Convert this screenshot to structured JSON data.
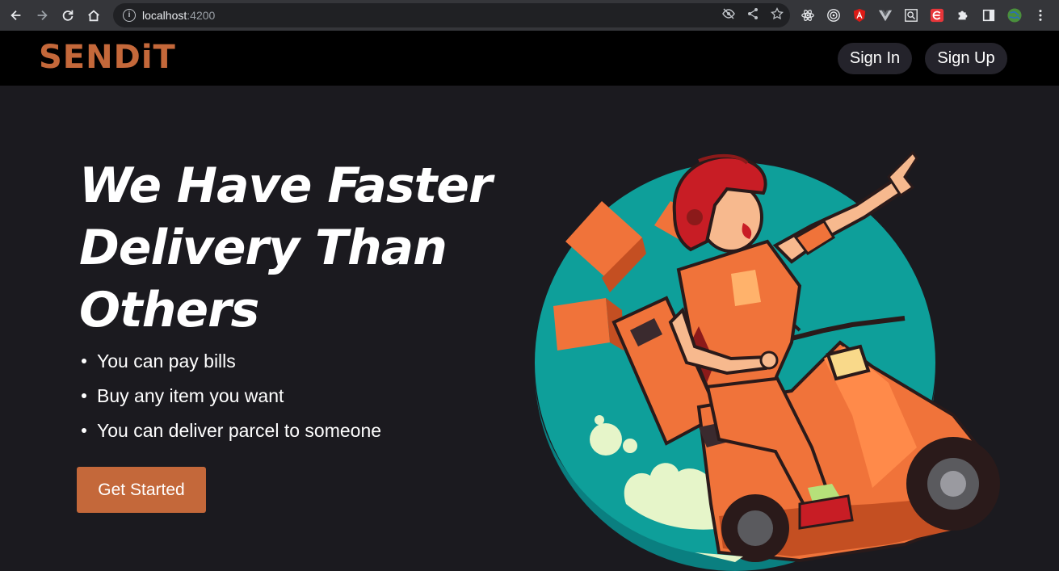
{
  "browser": {
    "url_host": "localhost",
    "url_port": ":4200",
    "nav_icons": [
      "back-arrow-icon",
      "forward-arrow-icon",
      "reload-icon",
      "home-icon"
    ],
    "omnibox_icons": [
      "info-icon",
      "eye-off-icon",
      "share-icon",
      "star-icon"
    ],
    "extension_icons": [
      "react-devtools-icon",
      "target-icon",
      "angular-icon",
      "vue-icon",
      "search-ext-icon",
      "e-ext-icon",
      "puzzle-icon",
      "sidepanel-icon",
      "profile-avatar-icon",
      "kebab-menu-icon"
    ]
  },
  "header": {
    "logo": "SENDiT",
    "sign_in": "Sign In",
    "sign_up": "Sign Up"
  },
  "hero": {
    "headline": "We Have Faster Delivery Than Others",
    "features": [
      "You can pay bills",
      "Buy any item you want",
      "You can deliver parcel to someone"
    ],
    "cta": "Get Started",
    "illustration": "delivery-rider-scooter-illustration"
  },
  "colors": {
    "accent": "#c4683a",
    "background": "#1b1a1f",
    "navbar": "#000000",
    "nav_button": "#24232b",
    "circle": "#13b0a8",
    "scooter": "#f0733a",
    "helmet": "#c81d25"
  }
}
